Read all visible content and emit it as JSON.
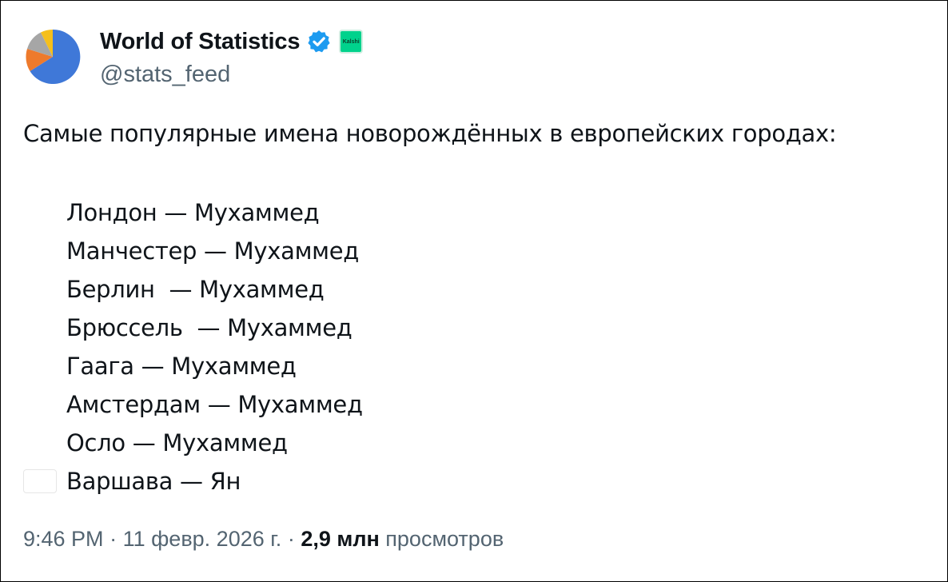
{
  "author": {
    "display_name": "World of Statistics",
    "handle": "@stats_feed",
    "avatar_icon": "pie-chart-icon",
    "verified_icon": "verified-badge-icon",
    "affiliate_badge_label": "Kalshi",
    "accent_color": "#1d9bf0"
  },
  "tweet": {
    "intro": "Самые популярные имена новорождённых в европейских городах:",
    "items": [
      {
        "flag": "uk-flag-icon",
        "text": "Лондон — Мухаммед"
      },
      {
        "flag": "uk-flag-icon",
        "text": "Манчестер — Мухаммед"
      },
      {
        "flag": "germany-flag-icon",
        "text": "Берлин  — Мухаммед"
      },
      {
        "flag": "belgium-flag-icon",
        "text": "Брюссель  — Мухаммед"
      },
      {
        "flag": "netherlands-flag-icon",
        "text": "Гаага — Мухаммед"
      },
      {
        "flag": "netherlands-flag-icon",
        "text": "Амстердам — Мухаммед"
      },
      {
        "flag": "norway-flag-icon",
        "text": "Осло — Мухаммед"
      },
      {
        "flag": "poland-flag-icon",
        "text": "Варшава — Ян"
      }
    ]
  },
  "meta": {
    "time": "9:46 PM",
    "separator": " · ",
    "date": "11 февр. 2026 г.",
    "views_count": "2,9 млн",
    "views_label": "просмотров"
  }
}
